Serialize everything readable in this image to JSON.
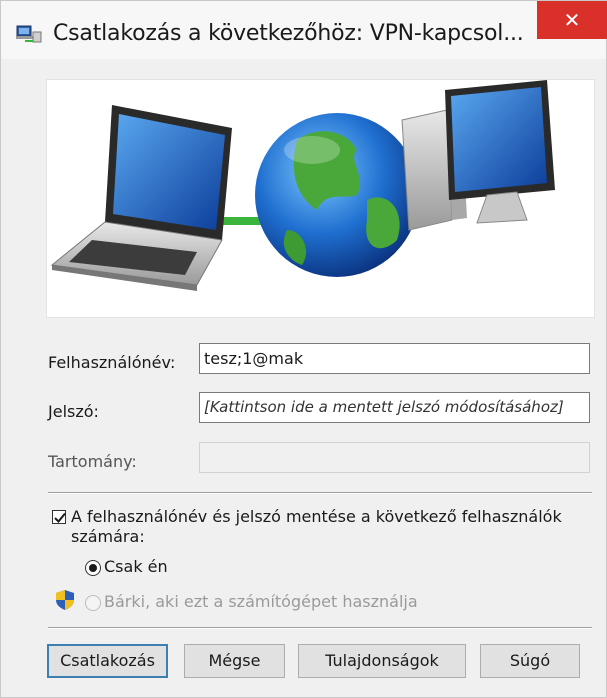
{
  "window": {
    "title": "Csatlakozás a következőhöz: VPN-kapcsol...",
    "close_glyph": "✕"
  },
  "banner": {
    "icons": [
      "laptop-icon",
      "globe-icon",
      "desktop-computer-icon"
    ],
    "link_color": "#3ab43a"
  },
  "form": {
    "username_label": "Felhasználónév:",
    "username_value": "tesz;1@mak",
    "password_label": "Jelszó:",
    "password_value": "[Kattintson ide a mentett jelszó módosításához]",
    "domain_label": "Tartomány:",
    "domain_value": ""
  },
  "save": {
    "checkbox_checked": true,
    "label_line1": "A felhasználónév és jelszó mentése a következő felhasználók",
    "label_line2": "számára:",
    "option_me": "Csak én",
    "option_anyone": "Bárki, aki ezt a számítógépet használja"
  },
  "buttons": {
    "connect": "Csatlakozás",
    "cancel": "Mégse",
    "properties": "Tulajdonságok",
    "help": "Súgó"
  },
  "colors": {
    "close_bg": "#d9302a",
    "default_button_border": "#3c7fb1",
    "window_bg": "#f0f0f0"
  }
}
